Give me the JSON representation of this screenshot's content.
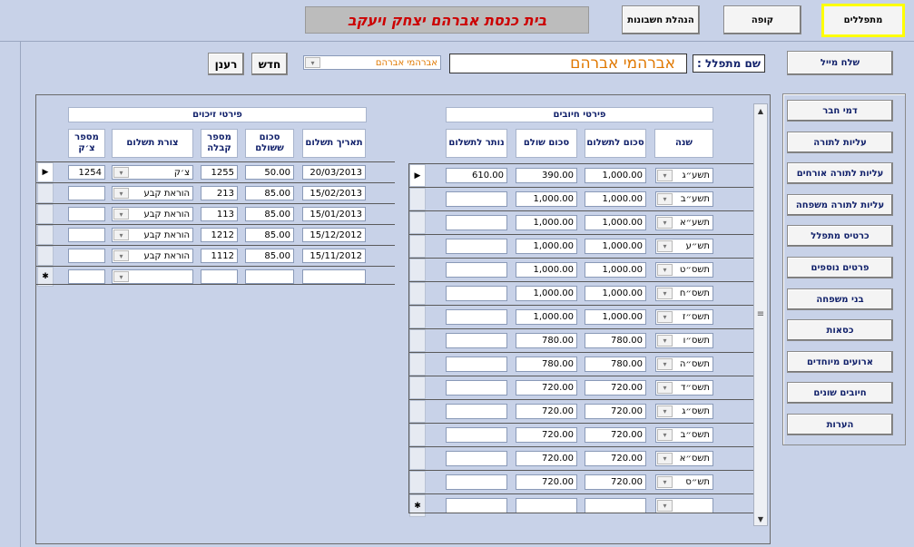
{
  "header": {
    "title": "בית כנסת אברהם יצחק ויעקב",
    "nav": [
      {
        "label": "מתפללים",
        "active": true
      },
      {
        "label": "קופה",
        "active": false
      },
      {
        "label": "הנהלת חשבונות",
        "active": false
      }
    ]
  },
  "search": {
    "label": "שם מתפלל :",
    "value": "אברהמי אברהם",
    "combo_value": "אברהמי אברהם",
    "new_label": "חדש",
    "refresh_label": "רענן",
    "mail_label": "שלח מייל"
  },
  "charges": {
    "title": "פירטי חיובים",
    "columns": [
      "שנה",
      "סכום לתשלום",
      "סכום שולם",
      "נותר לתשלום"
    ],
    "rows": [
      {
        "year": "תשע״ג",
        "due": "1,000.00",
        "paid": "390.00",
        "remain": "610.00"
      },
      {
        "year": "תשע״ב",
        "due": "1,000.00",
        "paid": "1,000.00",
        "remain": ""
      },
      {
        "year": "תשע״א",
        "due": "1,000.00",
        "paid": "1,000.00",
        "remain": ""
      },
      {
        "year": "תש״ע",
        "due": "1,000.00",
        "paid": "1,000.00",
        "remain": ""
      },
      {
        "year": "תשס״ט",
        "due": "1,000.00",
        "paid": "1,000.00",
        "remain": ""
      },
      {
        "year": "תשס״ח",
        "due": "1,000.00",
        "paid": "1,000.00",
        "remain": ""
      },
      {
        "year": "תשס״ז",
        "due": "1,000.00",
        "paid": "1,000.00",
        "remain": ""
      },
      {
        "year": "תשס״ו",
        "due": "780.00",
        "paid": "780.00",
        "remain": ""
      },
      {
        "year": "תשס״ה",
        "due": "780.00",
        "paid": "780.00",
        "remain": ""
      },
      {
        "year": "תשס״ד",
        "due": "720.00",
        "paid": "720.00",
        "remain": ""
      },
      {
        "year": "תשס״ג",
        "due": "720.00",
        "paid": "720.00",
        "remain": ""
      },
      {
        "year": "תשס״ב",
        "due": "720.00",
        "paid": "720.00",
        "remain": ""
      },
      {
        "year": "תשס״א",
        "due": "720.00",
        "paid": "720.00",
        "remain": ""
      },
      {
        "year": "תש״ס",
        "due": "720.00",
        "paid": "720.00",
        "remain": ""
      }
    ]
  },
  "credits": {
    "title": "פירטי זיכוים",
    "columns": [
      "תאריך תשלום",
      "סכום ששולם",
      "מספר קבלה",
      "צורת תשלום",
      "מספר צ׳ק"
    ],
    "rows": [
      {
        "date": "20/03/2013",
        "amount": "50.00",
        "receipt": "1255",
        "method": "צ׳ק",
        "check": "1254"
      },
      {
        "date": "15/02/2013",
        "amount": "85.00",
        "receipt": "213",
        "method": "הוראת קבע",
        "check": ""
      },
      {
        "date": "15/01/2013",
        "amount": "85.00",
        "receipt": "113",
        "method": "הוראת קבע",
        "check": ""
      },
      {
        "date": "15/12/2012",
        "amount": "85.00",
        "receipt": "1212",
        "method": "הוראת קבע",
        "check": ""
      },
      {
        "date": "15/11/2012",
        "amount": "85.00",
        "receipt": "1112",
        "method": "הוראת קבע",
        "check": ""
      }
    ]
  },
  "sidebar": [
    "דמי חבר",
    "עליות לתורה",
    "עליות לתורה אורחים",
    "עליות לתורה משפחה",
    "כרטיס מתפלל",
    "פרטים נוספים",
    "בני משפחה",
    "כסאות",
    "ארועים מיוחדים",
    "חיובים שונים",
    "הערות"
  ],
  "glyphs": {
    "current": "▶",
    "new": "✱",
    "arrow_down": "▾",
    "scroll_up": "▲",
    "scroll_down": "▼",
    "grip": "≡"
  }
}
